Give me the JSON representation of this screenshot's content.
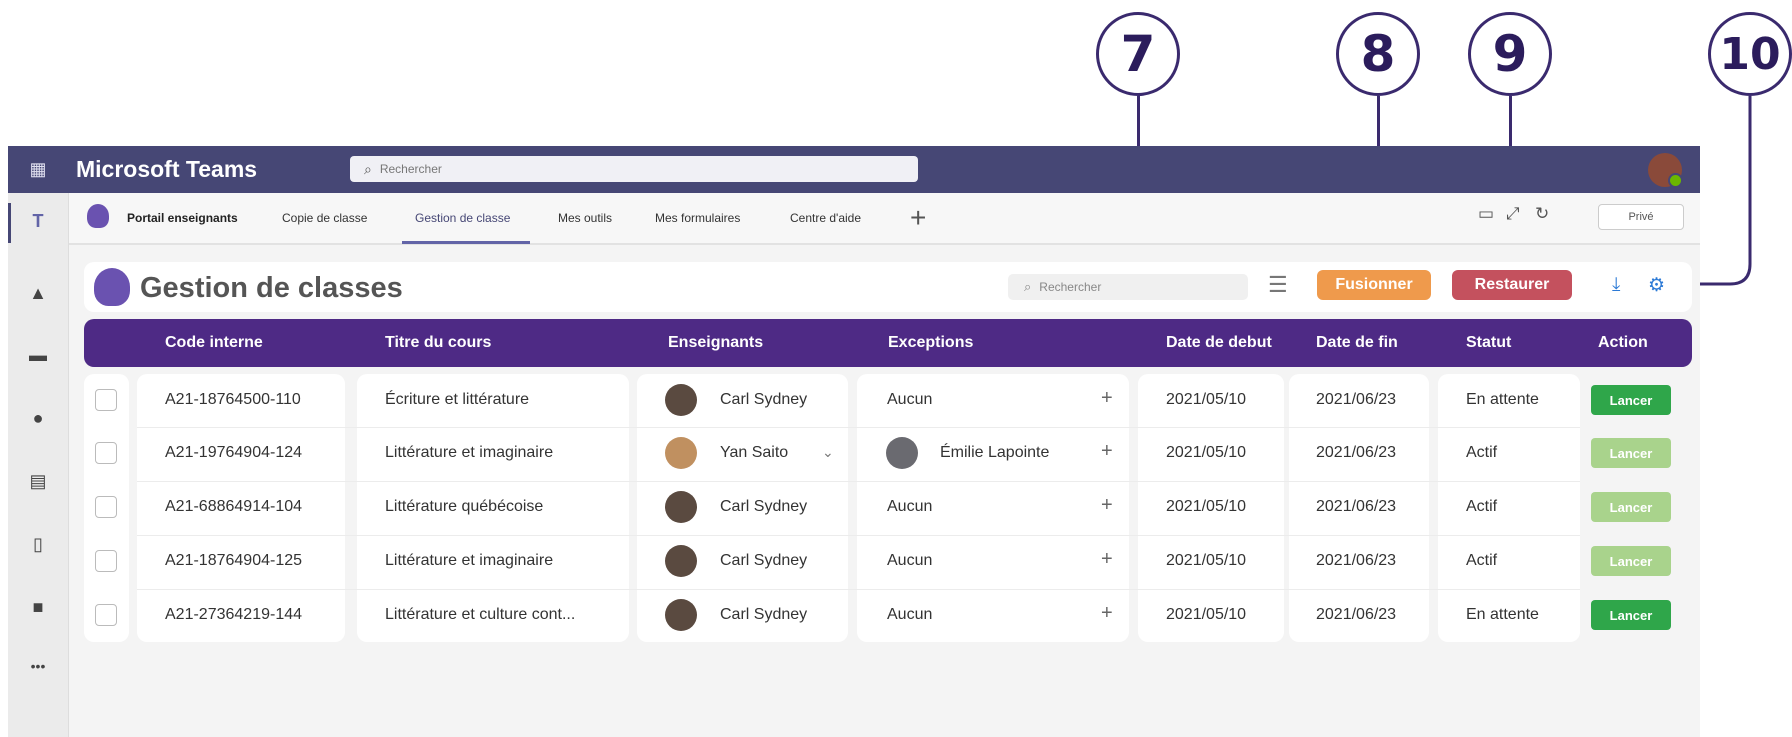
{
  "callouts": [
    "7",
    "8",
    "9",
    "10"
  ],
  "app": {
    "title": "Microsoft Teams",
    "search_placeholder": "Rechercher"
  },
  "rail": {
    "icons": [
      "teams-app-icon",
      "bell-icon",
      "chat-icon",
      "people-icon",
      "calendar-icon",
      "file-icon",
      "bag-icon",
      "more-icon"
    ],
    "more": "•••"
  },
  "tabs": [
    {
      "label": "Portail enseignants"
    },
    {
      "label": "Copie de classe"
    },
    {
      "label": "Gestion de classe"
    },
    {
      "label": "Mes outils"
    },
    {
      "label": "Mes formulaires"
    },
    {
      "label": "Centre d'aide"
    }
  ],
  "tabbar": {
    "add": "+",
    "prive": "Privé"
  },
  "header": {
    "title": "Gestion de classes",
    "search_placeholder": "Rechercher",
    "fusionner": "Fusionner",
    "restaurer": "Restaurer"
  },
  "columns": [
    "Code interne",
    "Titre du cours",
    "Enseignants",
    "Exceptions",
    "Date de debut",
    "Date de fin",
    "Statut",
    "Action"
  ],
  "rows": [
    {
      "code": "A21-18764500-110",
      "titre": "Écriture et littérature",
      "enseignant": "Carl Sydney",
      "exception": "Aucun",
      "debut": "2021/05/10",
      "fin": "2021/06/23",
      "statut": "En attente",
      "action": "Lancer"
    },
    {
      "code": "A21-19764904-124",
      "titre": "Littérature et imaginaire",
      "enseignant": "Yan Saito",
      "exception": "Émilie Lapointe",
      "debut": "2021/05/10",
      "fin": "2021/06/23",
      "statut": "Actif",
      "action": "Lancer"
    },
    {
      "code": "A21-68864914-104",
      "titre": "Littérature québécoise",
      "enseignant": "Carl Sydney",
      "exception": "Aucun",
      "debut": "2021/05/10",
      "fin": "2021/06/23",
      "statut": "Actif",
      "action": "Lancer"
    },
    {
      "code": "A21-18764904-125",
      "titre": "Littérature et imaginaire",
      "enseignant": "Carl Sydney",
      "exception": "Aucun",
      "debut": "2021/05/10",
      "fin": "2021/06/23",
      "statut": "Actif",
      "action": "Lancer"
    },
    {
      "code": "A21-27364219-144",
      "titre": "Littérature et culture cont...",
      "enseignant": "Carl Sydney",
      "exception": "Aucun",
      "debut": "2021/05/10",
      "fin": "2021/06/23",
      "statut": "En attente",
      "action": "Lancer"
    }
  ],
  "colors": {
    "frame": "#464775",
    "header": "#4e2a85",
    "fusionner": "#ef9a4c",
    "restaurer": "#c4515e",
    "lancer_active": "#2fa64a",
    "lancer_inactive": "#a9d38c"
  }
}
